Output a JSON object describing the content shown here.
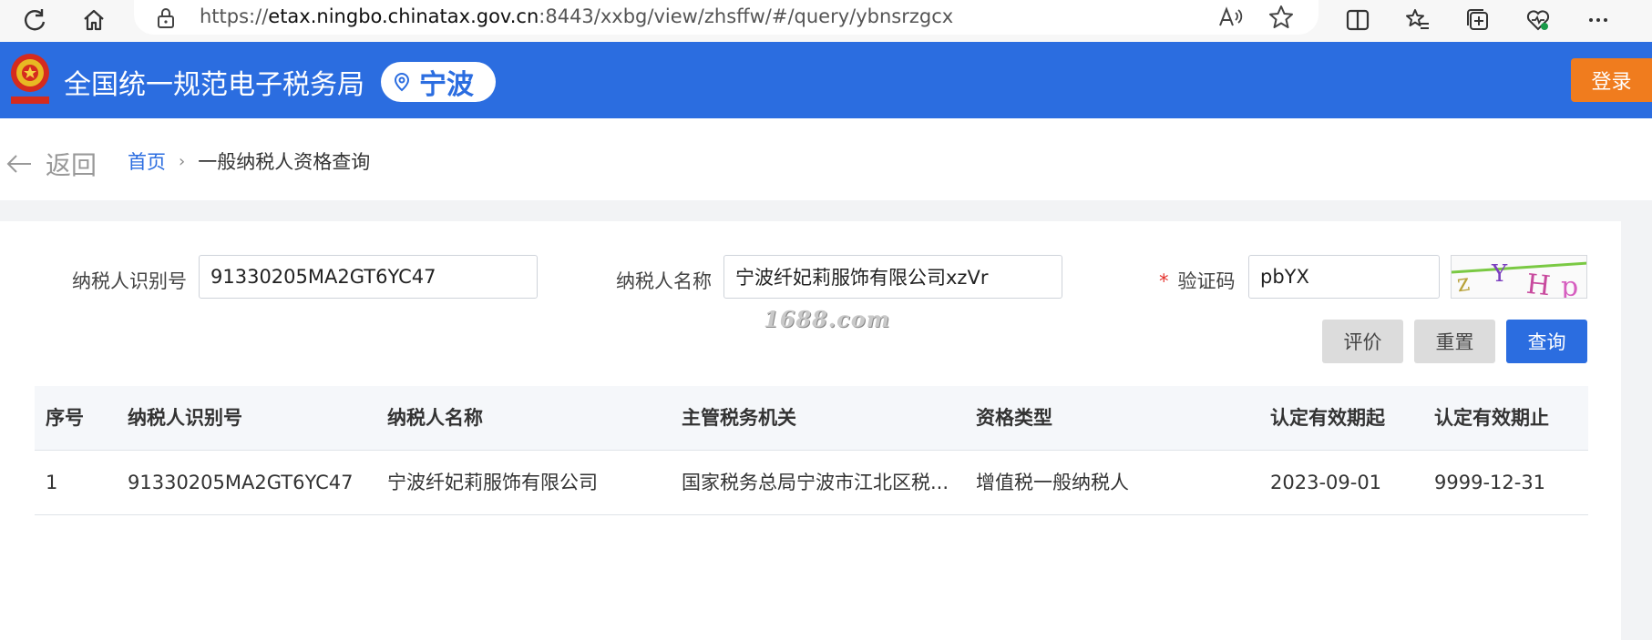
{
  "browser": {
    "url_prefix": "https://",
    "url_host": "etax.ningbo.chinatax.gov.cn",
    "url_rest": ":8443/xxbg/view/zhsffw/#/query/ybnsrzgcx"
  },
  "header": {
    "site_title": "全国统一规范电子税务局",
    "city": "宁波",
    "login_label": "登录",
    "brand_color": "#2b6de0",
    "login_color": "#f07c1e"
  },
  "breadcrumb": {
    "back_label": "返回",
    "home": "首页",
    "separator": "›",
    "current": "一般纳税人资格查询"
  },
  "form": {
    "tax_id_label": "纳税人识别号",
    "tax_id_value": "91330205MA2GT6YC47",
    "name_label": "纳税人名称",
    "name_value": "宁波纤妃莉服饰有限公司xzVr",
    "captcha_required_mark": "*",
    "captcha_label": "验证码",
    "captcha_value": "pbYX",
    "captcha_image_text": "zYHp"
  },
  "watermark": "1688.com",
  "buttons": {
    "evaluate": "评价",
    "reset": "重置",
    "query": "查询"
  },
  "table": {
    "columns": [
      "序号",
      "纳税人识别号",
      "纳税人名称",
      "主管税务机关",
      "资格类型",
      "认定有效期起",
      "认定有效期止"
    ],
    "rows": [
      [
        "1",
        "91330205MA2GT6YC47",
        "宁波纤妃莉服饰有限公司",
        "国家税务总局宁波市江北区税...",
        "增值税一般纳税人",
        "2023-09-01",
        "9999-12-31"
      ]
    ]
  }
}
